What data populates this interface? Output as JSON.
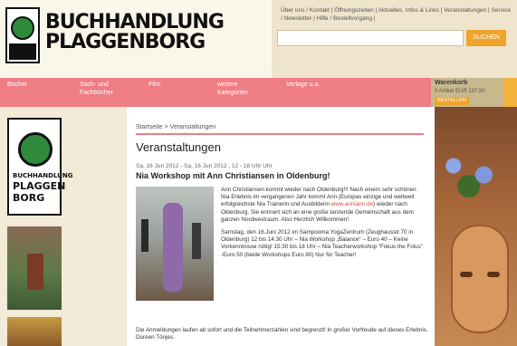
{
  "brand": {
    "line1": "BUCHHANDLUNG",
    "line2": "PLAGGENBORG"
  },
  "top_links": "Über uns / Kontakt | Öffnungszeiten | Aktuelles, Infos & Links | Veranstaltungen | Service / Newsletter | Hilfe / Bestellvorgang |",
  "search": {
    "placeholder": "",
    "button_label": "SUCHEN"
  },
  "nav": [
    {
      "label": "Bücher"
    },
    {
      "label": "Sach- und Fachbücher"
    },
    {
      "label": "Film"
    },
    {
      "label": "weitere Kategorien"
    },
    {
      "label": "Verlage u.a."
    }
  ],
  "cart": {
    "title": "Warenkorb",
    "summary": "0 Artikel  EUR  137,50",
    "button_label": "BESTELLEN"
  },
  "sidebar": {
    "brand_line1": "BUCHHANDLUNG",
    "brand_line2": "PLAGGEN",
    "brand_line3": "BORG"
  },
  "breadcrumb": "Startseite > Veranstaltungen",
  "page_title": "Veranstaltungen",
  "event": {
    "date": "Sa, 16 Jun 2012 - Sa, 16 Jun 2012 , 12 - 18 Uhr Uhr",
    "title": "Nia Workshop mit Ann Christiansen in Oldenburg!",
    "paragraph1_before": "Ann Christiansen kommt wieder nach Oldenburg!!! Nach einem sehr schönen Nia Erlebnis im vergangenen Jahr kommt Ann (Europas einzige und weltweit erfolgreichste Nia Trainerin und Ausbilderin ",
    "paragraph1_link": "www.anniann.de",
    "paragraph1_after": ") wieder nach Oldenburg. Sie erinnert sich an eine große tanzende Gemeinschaft aus dem ganzen Nordwestraum. Also Herzlich Willkommen!",
    "paragraph2": "Samstag, den 16.Juni 2012 im Sampooma YogaZentrum (Zeughausstr.70 in Oldenburg) 12 bis 14:30 Uhr – Nia Workshop „Balance“ – Euro 40 – Keine Vorkenntnisse nötig! 15:30 bis 18 Uhr – Nia Teacherworkshop “Fokus the Folus” -Euro 50 (beide Workshops Euro 80) Nur für Teacher!",
    "footer": "Die Anmeldungen laufen ab sofort und die Teilnehmerzahlen sind begrenzt! In großer Vorfreude auf dieses Erlebnis. Doreen Tönjes."
  }
}
